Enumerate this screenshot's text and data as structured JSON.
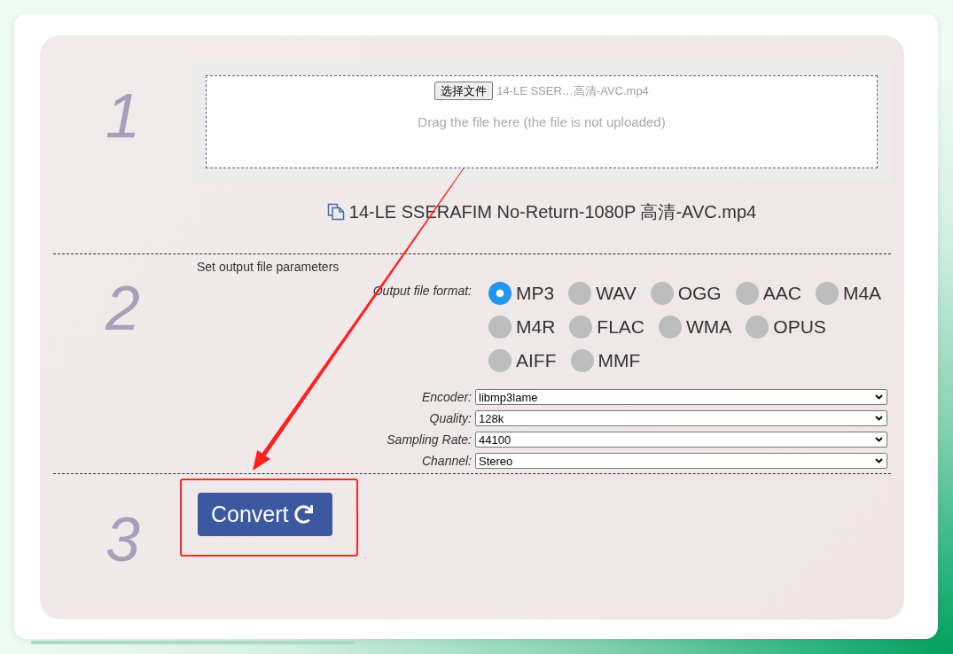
{
  "upload": {
    "step": "1",
    "choose_button": "选择文件",
    "chosen_file": "14-LE SSER…高清-AVC.mp4",
    "drop_hint": "Drag the file here (the file is not uploaded)",
    "file_name": "14-LE SSERAFIM No-Return-1080P 高清-AVC.mp4"
  },
  "parameters": {
    "step": "2",
    "heading": "Set output file parameters",
    "format_label": "Output file format:",
    "formats": [
      {
        "label": "MP3",
        "selected": true
      },
      {
        "label": "WAV",
        "selected": false
      },
      {
        "label": "OGG",
        "selected": false
      },
      {
        "label": "AAC",
        "selected": false
      },
      {
        "label": "M4A",
        "selected": false
      },
      {
        "label": "M4R",
        "selected": false
      },
      {
        "label": "FLAC",
        "selected": false
      },
      {
        "label": "WMA",
        "selected": false
      },
      {
        "label": "OPUS",
        "selected": false
      },
      {
        "label": "AIFF",
        "selected": false
      },
      {
        "label": "MMF",
        "selected": false
      }
    ],
    "settings": [
      {
        "label": "Encoder:",
        "value": "libmp3lame"
      },
      {
        "label": "Quality:",
        "value": "128k"
      },
      {
        "label": "Sampling Rate:",
        "value": "44100"
      },
      {
        "label": "Channel:",
        "value": "Stereo"
      }
    ]
  },
  "convert": {
    "step": "3",
    "button": "Convert"
  }
}
